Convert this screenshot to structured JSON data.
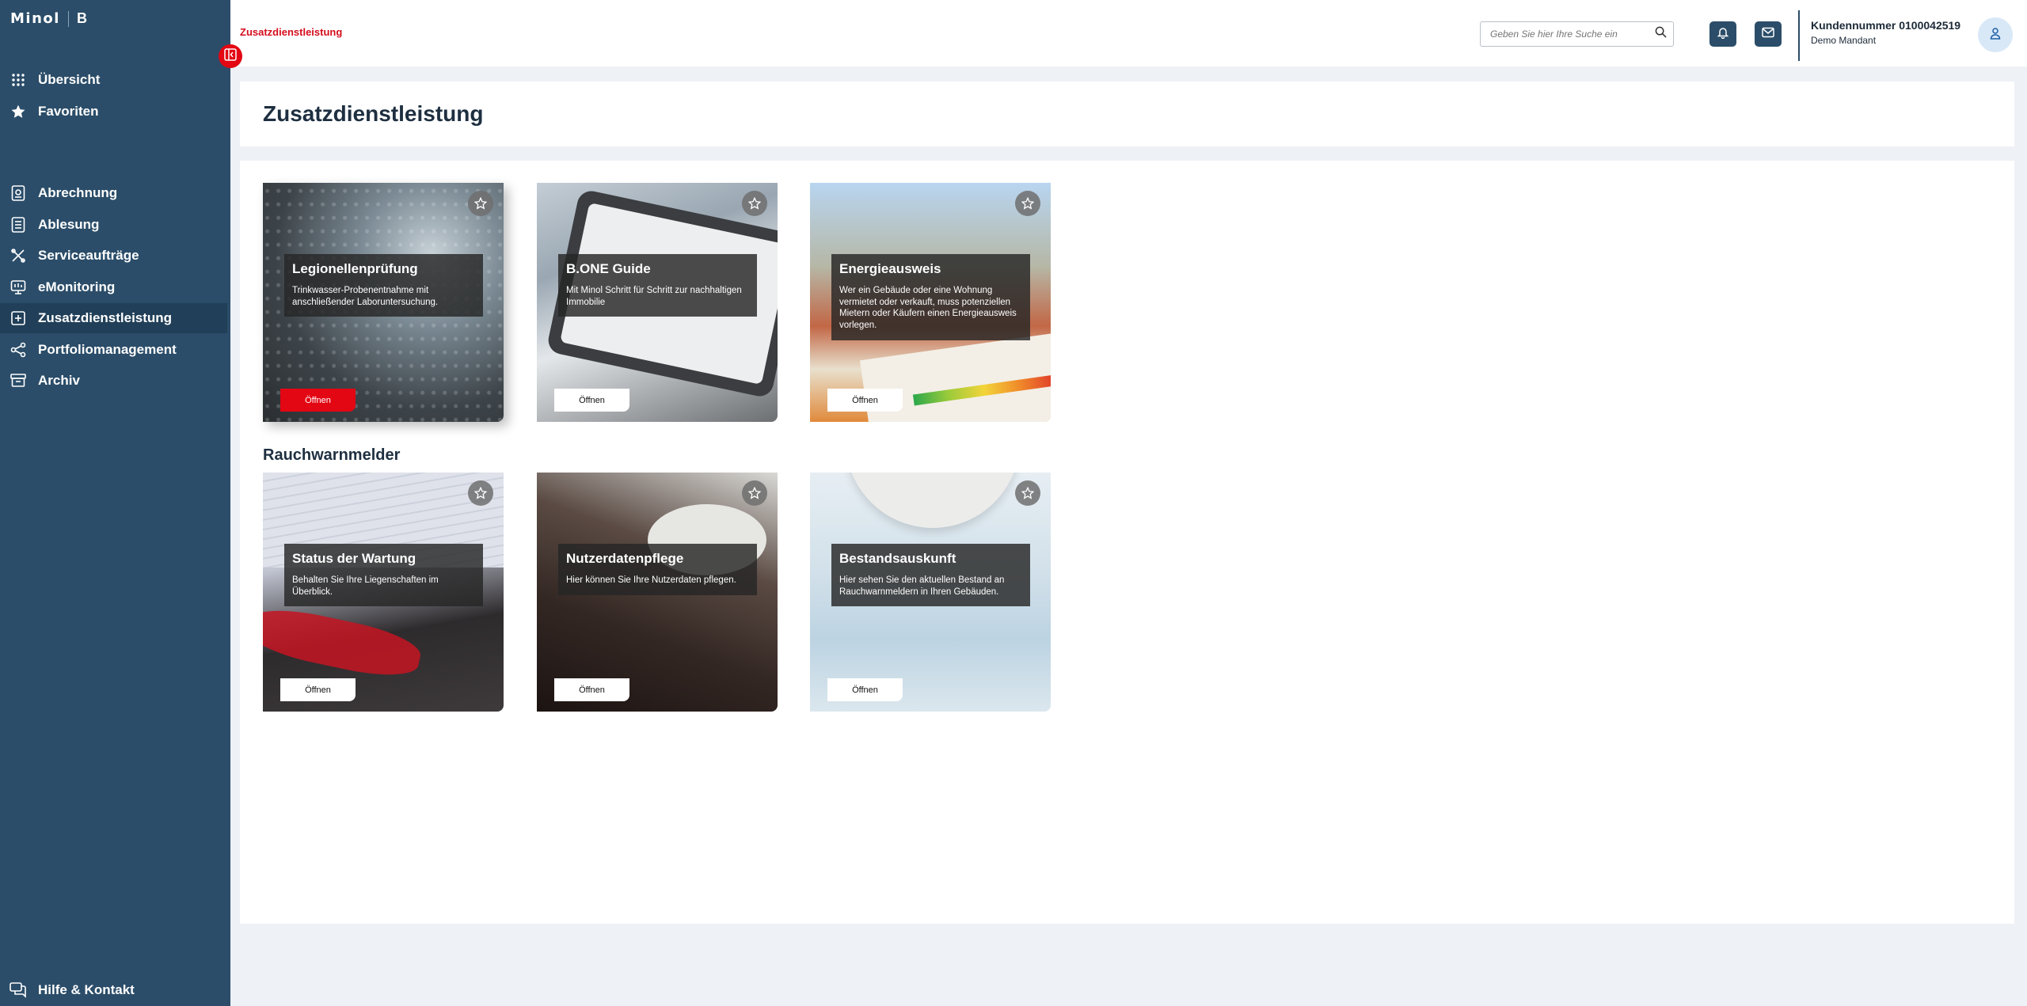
{
  "brand": {
    "logo_text": "Minol",
    "logo_suffix": "B"
  },
  "sidebar": {
    "top_items": [
      {
        "label": "Übersicht",
        "icon": "grid-icon"
      },
      {
        "label": "Favoriten",
        "icon": "star-icon"
      }
    ],
    "items": [
      {
        "label": "Abrechnung",
        "icon": "document-icon"
      },
      {
        "label": "Ablesung",
        "icon": "meter-icon"
      },
      {
        "label": "Serviceaufträge",
        "icon": "tools-icon"
      },
      {
        "label": "eMonitoring",
        "icon": "monitor-icon"
      },
      {
        "label": "Zusatzdienstleistung",
        "icon": "plus-square-icon",
        "active": true
      },
      {
        "label": "Portfoliomanagement",
        "icon": "share-icon"
      },
      {
        "label": "Archiv",
        "icon": "archive-icon"
      }
    ],
    "help": {
      "label": "Hilfe & Kontakt",
      "icon": "chat-icon"
    }
  },
  "topbar": {
    "breadcrumb": "Zusatzdienstleistung",
    "search_placeholder": "Geben Sie hier Ihre Suche ein",
    "customer_number": "Kundennummer 0100042519",
    "tenant": "Demo Mandant"
  },
  "page": {
    "title": "Zusatzdienstleistung"
  },
  "sections": [
    {
      "title": "",
      "cards": [
        {
          "title": "Legionellenprüfung",
          "description": "Trinkwasser-Probenentnahme mit anschließender Laboruntersuchung.",
          "button": "Öffnen",
          "highlighted": true
        },
        {
          "title": "B.ONE Guide",
          "description": "Mit Minol Schritt für Schritt zur nachhaltigen Immobilie",
          "button": "Öffnen"
        },
        {
          "title": "Energieausweis",
          "description": "Wer ein Gebäude oder eine Wohnung vermietet oder verkauft, muss potenziellen Mietern oder Käufern einen Energieausweis vorlegen.",
          "button": "Öffnen"
        }
      ]
    },
    {
      "title": "Rauchwarnmelder",
      "cards": [
        {
          "title": "Status der Wartung",
          "description": "Behalten Sie Ihre Liegenschaften im Überblick.",
          "button": "Öffnen"
        },
        {
          "title": "Nutzerdatenpflege",
          "description": "Hier können Sie Ihre Nutzerdaten pflegen.",
          "button": "Öffnen"
        },
        {
          "title": "Bestandsauskunft",
          "description": "Hier sehen Sie den aktuellen Bestand an Rauchwarnmeldern in Ihren Gebäuden.",
          "button": "Öffnen"
        }
      ]
    }
  ],
  "colors": {
    "sidebar": "#2b4d69",
    "accent": "#e30613",
    "active_nav": "#213f58"
  }
}
